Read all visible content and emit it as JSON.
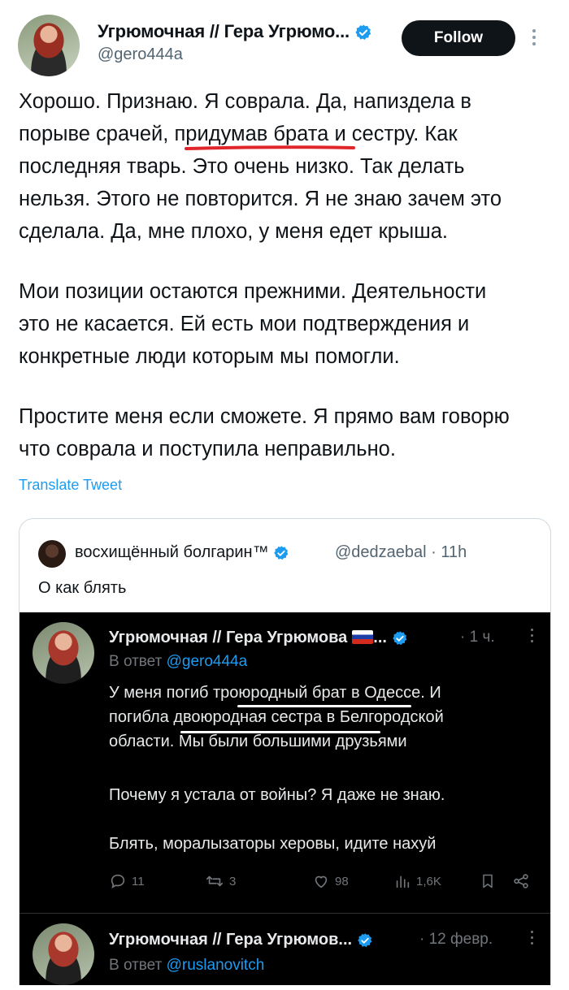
{
  "tweet": {
    "author_name": "Угрюмочная // Гера Угрюмо...",
    "author_handle": "@gero444a",
    "follow_label": "Follow",
    "paragraphs": [
      "Хорошо. Признаю. Я соврала. Да, напиздела в\nпорыве срачей, придумав брата и сестру. Как\nпоследняя тварь. Это очень низко. Так делать\nнельзя. Этого не повторится. Я не знаю зачем это\nсделала. Да, мне плохо, у меня едет крыша.",
      "Мои позиции остаются прежними. Деятельности\nэто не касается. Ей есть мои подтверждения и\nконкретные люди которым мы помогли.",
      "Простите меня если сможете. Я прямо вам говорю\nчто соврала и поступила неправильно."
    ],
    "translate_label": "Translate Tweet"
  },
  "quote": {
    "author_name": "восхищённый болгарин™",
    "meta": "@dedzaebal · 11h",
    "text": "О как блять",
    "embedded": [
      {
        "author_name": "Угрюмочная // Гера Угрюмова",
        "name_suffix": "...",
        "time": "· 1 ч.",
        "reply_prefix": "В ответ ",
        "reply_to": "@gero444a",
        "paragraphs": [
          "У меня погиб троюродный брат в Одессе. И\nпогибла двоюродная сестра в Белгородской\nобласти. Мы были большими друзьями",
          "Почему я устала от войны? Я даже не знаю.",
          "Блять, моралызаторы херовы, идите нахуй"
        ],
        "stats": {
          "replies": "11",
          "retweets": "3",
          "likes": "98",
          "views": "1,6K"
        }
      },
      {
        "author_name": "Угрюмочная // Гера Угрюмов...",
        "time": "· 12 февр.",
        "reply_prefix": "В ответ ",
        "reply_to": "@ruslanovitch"
      }
    ]
  },
  "colors": {
    "accent": "#1d9bf0",
    "underline": "#e0262b"
  }
}
